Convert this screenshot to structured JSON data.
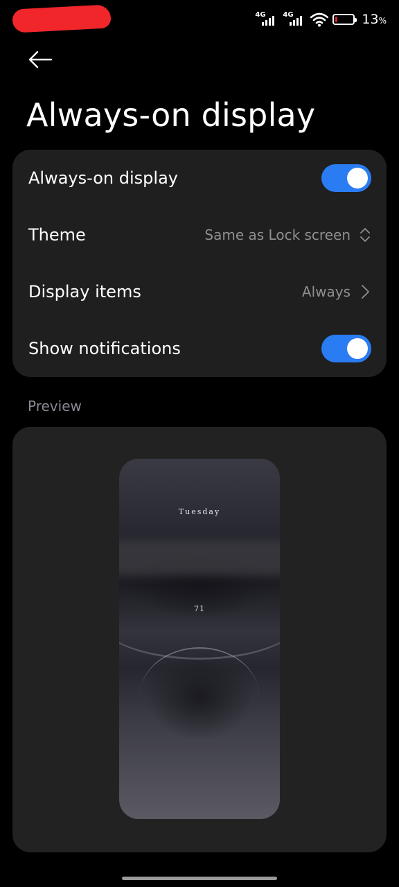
{
  "status_bar": {
    "network1": "4G",
    "network2": "4G",
    "battery_percent": "13",
    "battery_unit": "%",
    "battery_level": 0.13,
    "battery_color": "#e0242a"
  },
  "header": {
    "back_icon": "arrow-left-icon",
    "title": "Always-on display"
  },
  "settings": {
    "aod": {
      "label": "Always-on display",
      "enabled": true
    },
    "theme": {
      "label": "Theme",
      "value": "Same as Lock screen",
      "icon": "chevron-up-down-icon"
    },
    "display_items": {
      "label": "Display items",
      "value": "Always",
      "icon": "chevron-right-icon"
    },
    "notifications": {
      "label": "Show notifications",
      "enabled": true
    }
  },
  "preview": {
    "section_label": "Preview",
    "day_text": "Tuesday",
    "number_text": "71"
  },
  "colors": {
    "accent": "#2a7cf2",
    "card_bg": "#1f1f1f",
    "secondary_text": "#8f8f8f"
  }
}
